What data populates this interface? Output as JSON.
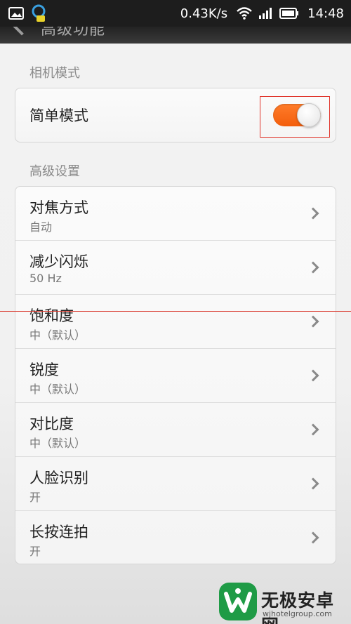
{
  "status_bar": {
    "speed": "0.43K/s",
    "time": "14:48"
  },
  "title_bar": {
    "title": "高级功能"
  },
  "camera_mode": {
    "section_label": "相机模式",
    "simple_mode_label": "简单模式",
    "simple_mode_on": true,
    "accent_color": "#f46a1c"
  },
  "advanced": {
    "section_label": "高级设置",
    "items": [
      {
        "title": "对焦方式",
        "value": "自动"
      },
      {
        "title": "减少闪烁",
        "value": "50 Hz"
      },
      {
        "title": "饱和度",
        "value": "中（默认）"
      },
      {
        "title": "锐度",
        "value": "中（默认）"
      },
      {
        "title": "对比度",
        "value": "中（默认）"
      },
      {
        "title": "人脸识别",
        "value": "开"
      },
      {
        "title": "长按连拍",
        "value": "开"
      }
    ]
  },
  "watermark": {
    "title": "无极安卓网",
    "url": "wjhotelgroup.com"
  }
}
